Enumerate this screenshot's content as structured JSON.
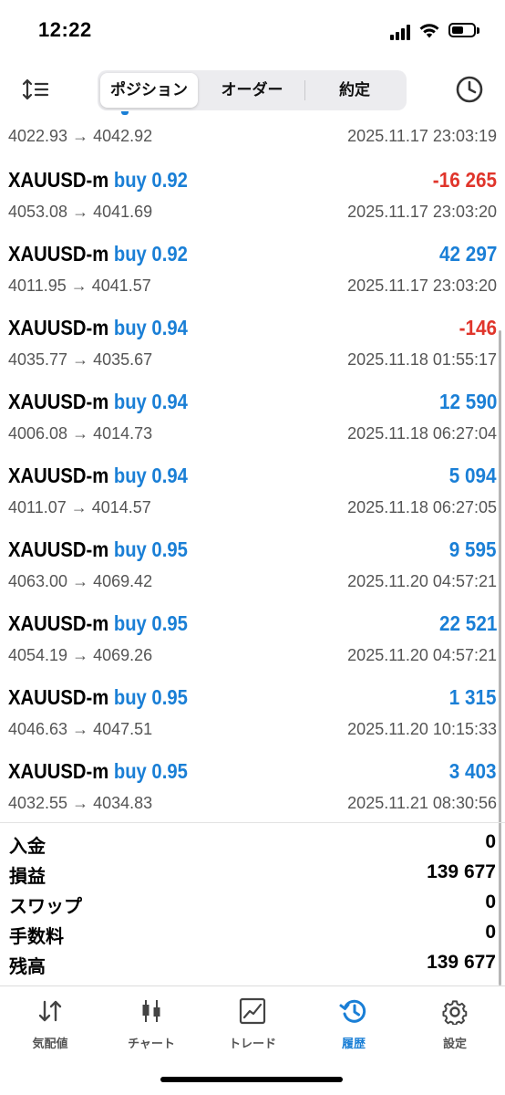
{
  "status_bar": {
    "time": "12:22",
    "battery_level": 0.55
  },
  "toolbar": {
    "tabs": [
      {
        "label": "ポジション",
        "active": true
      },
      {
        "label": "オーダー",
        "active": false
      },
      {
        "label": "約定",
        "active": false
      }
    ]
  },
  "partial_row": {
    "prices": "4022.93 → 4042.92",
    "datetime": "2025.11.17 23:03:19"
  },
  "trades": [
    {
      "symbol": "XAUUSD-m",
      "side": "buy 0.92",
      "profit": "-16 265",
      "sign": "neg",
      "prices": "4053.08 → 4041.69",
      "datetime": "2025.11.17 23:03:20"
    },
    {
      "symbol": "XAUUSD-m",
      "side": "buy 0.92",
      "profit": "42 297",
      "sign": "pos",
      "prices": "4011.95 → 4041.57",
      "datetime": "2025.11.17 23:03:20"
    },
    {
      "symbol": "XAUUSD-m",
      "side": "buy 0.94",
      "profit": "-146",
      "sign": "neg",
      "prices": "4035.77 → 4035.67",
      "datetime": "2025.11.18 01:55:17"
    },
    {
      "symbol": "XAUUSD-m",
      "side": "buy 0.94",
      "profit": "12 590",
      "sign": "pos",
      "prices": "4006.08 → 4014.73",
      "datetime": "2025.11.18 06:27:04"
    },
    {
      "symbol": "XAUUSD-m",
      "side": "buy 0.94",
      "profit": "5 094",
      "sign": "pos",
      "prices": "4011.07 → 4014.57",
      "datetime": "2025.11.18 06:27:05"
    },
    {
      "symbol": "XAUUSD-m",
      "side": "buy 0.95",
      "profit": "9 595",
      "sign": "pos",
      "prices": "4063.00 → 4069.42",
      "datetime": "2025.11.20 04:57:21"
    },
    {
      "symbol": "XAUUSD-m",
      "side": "buy 0.95",
      "profit": "22 521",
      "sign": "pos",
      "prices": "4054.19 → 4069.26",
      "datetime": "2025.11.20 04:57:21"
    },
    {
      "symbol": "XAUUSD-m",
      "side": "buy 0.95",
      "profit": "1 315",
      "sign": "pos",
      "prices": "4046.63 → 4047.51",
      "datetime": "2025.11.20 10:15:33"
    },
    {
      "symbol": "XAUUSD-m",
      "side": "buy 0.95",
      "profit": "3 403",
      "sign": "pos",
      "prices": "4032.55 → 4034.83",
      "datetime": "2025.11.21 08:30:56"
    }
  ],
  "summary": [
    {
      "label": "入金",
      "value": "0"
    },
    {
      "label": "損益",
      "value": "139 677"
    },
    {
      "label": "スワップ",
      "value": "0"
    },
    {
      "label": "手数料",
      "value": "0"
    },
    {
      "label": "残高",
      "value": "139 677"
    }
  ],
  "tabbar": [
    {
      "label": "気配値",
      "icon": "quotes-arrows-icon",
      "active": false
    },
    {
      "label": "チャート",
      "icon": "candlestick-icon",
      "active": false
    },
    {
      "label": "トレード",
      "icon": "trade-chart-icon",
      "active": false
    },
    {
      "label": "履歴",
      "icon": "history-icon",
      "active": true
    },
    {
      "label": "設定",
      "icon": "gear-icon",
      "active": false
    }
  ],
  "colors": {
    "accent": "#1a7fd6",
    "negative": "#e0352b",
    "secondary_text": "#555555"
  }
}
